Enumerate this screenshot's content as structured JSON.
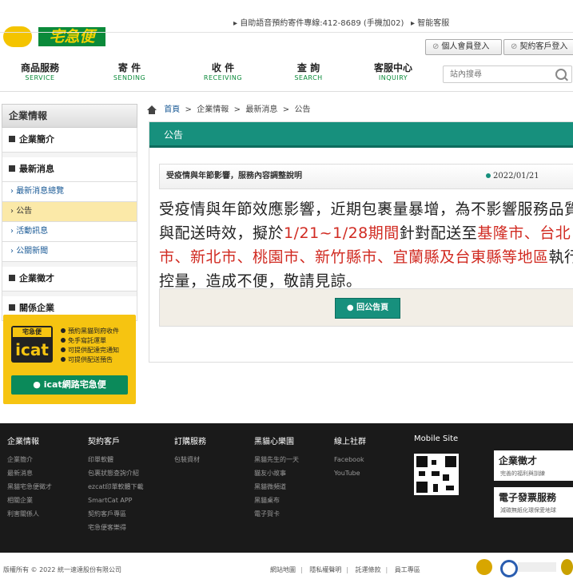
{
  "brand": {
    "name": "宅急便"
  },
  "top_links": {
    "phone": "自助語音預約寄件專線:412-8689 (手機加02)",
    "smart_service": "智能客服"
  },
  "login": {
    "member": "個人會員登入",
    "contract": "契約客戶登入"
  },
  "nav": [
    {
      "zh": "商品服務",
      "en": "SERVICE"
    },
    {
      "zh": "寄 件",
      "en": "SENDING"
    },
    {
      "zh": "收 件",
      "en": "RECEIVING"
    },
    {
      "zh": "查 詢",
      "en": "SEARCH"
    },
    {
      "zh": "客服中心",
      "en": "INQUIRY"
    }
  ],
  "search": {
    "placeholder": "站內搜尋"
  },
  "sidebar": {
    "title": "企業情報",
    "items": [
      {
        "label": "企業簡介"
      },
      {
        "label": "最新消息"
      },
      {
        "label": "最新消息總覽"
      },
      {
        "label": "公告"
      },
      {
        "label": "活動訊息"
      },
      {
        "label": "公關新聞"
      },
      {
        "label": "企業徵才"
      },
      {
        "label": "關係企業"
      }
    ]
  },
  "icat": {
    "logo_top": "宅急便",
    "logo": "icat",
    "features": [
      "預約黑貓到府收件",
      "免手寫託運單",
      "可提供配達完通知",
      "可提供配送預告"
    ],
    "button": "icat網路宅急便"
  },
  "breadcrumb": {
    "home": "首頁",
    "level1": "企業情報",
    "level2": "最新消息",
    "current": "公告",
    "sep": ">"
  },
  "panel": {
    "heading": "公告",
    "news_title": "受疫情與年節影響，服務內容調整說明",
    "news_date": "2022/01/21",
    "body": {
      "p1": "受疫情與年節效應影響，近期包裹量暴增，為不影響服務品質與配送時效，擬於",
      "p2_red": "1/21~1/28期間",
      "p3": "針對配送至",
      "p4_red": "基隆市、台北市、新北市、桃園市、新竹縣市、宜蘭縣及台東縣等地區",
      "p5": "執行控量，造成不便，敬請見諒。"
    },
    "back": "回公告頁"
  },
  "footer": {
    "cols": [
      {
        "head": "企業情報",
        "links": [
          "企業簡介",
          "最新消息",
          "黑貓宅急便徵才",
          "相關企業",
          "利害關係人"
        ]
      },
      {
        "head": "契約客戶",
        "links": [
          "印單軟體",
          "包裹狀態查詢介紹",
          "ezcat印單軟體下載",
          "SmartCat APP",
          "契約客戶專區",
          "宅急便客樂得"
        ]
      },
      {
        "head": "訂購服務",
        "links": [
          "包裝資材"
        ]
      },
      {
        "head": "黑貓心樂園",
        "links": [
          "黑貓先生的一天",
          "貓友小故事",
          "黑貓微頻道",
          "黑貓桌布",
          "電子賀卡"
        ]
      },
      {
        "head": "線上社群",
        "links": [
          "Facebook",
          "YouTube"
        ]
      }
    ],
    "mobile": "Mobile Site",
    "banner1": {
      "title": "企業徵才",
      "sub": "完善的福利與訓練"
    },
    "banner2": {
      "title": "電子發票服務",
      "sub": "減碳無紙化環保愛地球"
    },
    "copyright": "版權所有 © 2022 統一速達股份有限公司",
    "links": [
      "網站地圖",
      "隱私權聲明",
      "託運條款",
      "員工專區"
    ]
  },
  "colors": {
    "brand_green": "#0b8a3a",
    "teal": "#17907d",
    "yellow": "#f6c411",
    "red": "#d12b22"
  }
}
